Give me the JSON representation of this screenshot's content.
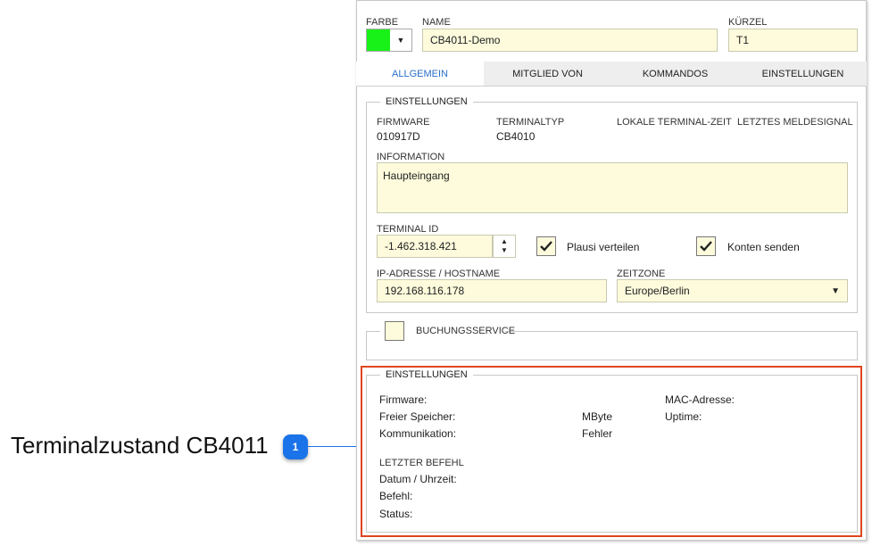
{
  "callout": {
    "text": "Terminalzustand CB4011",
    "badge": "1"
  },
  "header": {
    "farbe_label": "FARBE",
    "farbe_color": "#19f219",
    "name_label": "NAME",
    "name_value": "CB4011-Demo",
    "kuerzel_label": "KÜRZEL",
    "kuerzel_value": "T1"
  },
  "tabs": [
    {
      "label": "ALLGEMEIN",
      "active": true
    },
    {
      "label": "MITGLIED VON",
      "active": false
    },
    {
      "label": "KOMMANDOS",
      "active": false
    },
    {
      "label": "EINSTELLUNGEN",
      "active": false
    }
  ],
  "settings": {
    "title": "EINSTELLUNGEN",
    "firmware_label": "FIRMWARE",
    "firmware_value": "010917D",
    "terminaltyp_label": "TERMINALTYP",
    "terminaltyp_value": "CB4010",
    "lokale_zeit_label": "LOKALE TERMINAL-ZEIT",
    "letztes_signal_label": "LETZTES MELDESIGNAL",
    "information_label": "INFORMATION",
    "information_value": "Haupteingang",
    "terminal_id_label": "TERMINAL ID",
    "terminal_id_value": "-1.462.318.421",
    "plausi_label": "Plausi verteilen",
    "plausi_checked": true,
    "konten_label": "Konten senden",
    "konten_checked": true,
    "ip_label": "IP-ADRESSE / HOSTNAME",
    "ip_value": "192.168.116.178",
    "zeitzone_label": "ZEITZONE",
    "zeitzone_value": "Europe/Berlin"
  },
  "buchungsservice": {
    "label": "BUCHUNGSSERVICE",
    "checked": false
  },
  "status": {
    "title": "EINSTELLUNGEN",
    "firmware": "Firmware:",
    "mac": "MAC-Adresse:",
    "speicher": "Freier Speicher:",
    "mbyte": "MByte",
    "uptime": "Uptime:",
    "kommunikation": "Kommunikation:",
    "fehler": "Fehler",
    "letzter_befehl": "LETZTER BEFEHL",
    "datum": "Datum / Uhrzeit:",
    "befehl": "Befehl:",
    "status": "Status:"
  },
  "icons": {
    "dropdown": "chevron-down-icon",
    "check": "check-icon",
    "spinner_up": "arrow-up-icon",
    "spinner_down": "arrow-down-icon"
  }
}
